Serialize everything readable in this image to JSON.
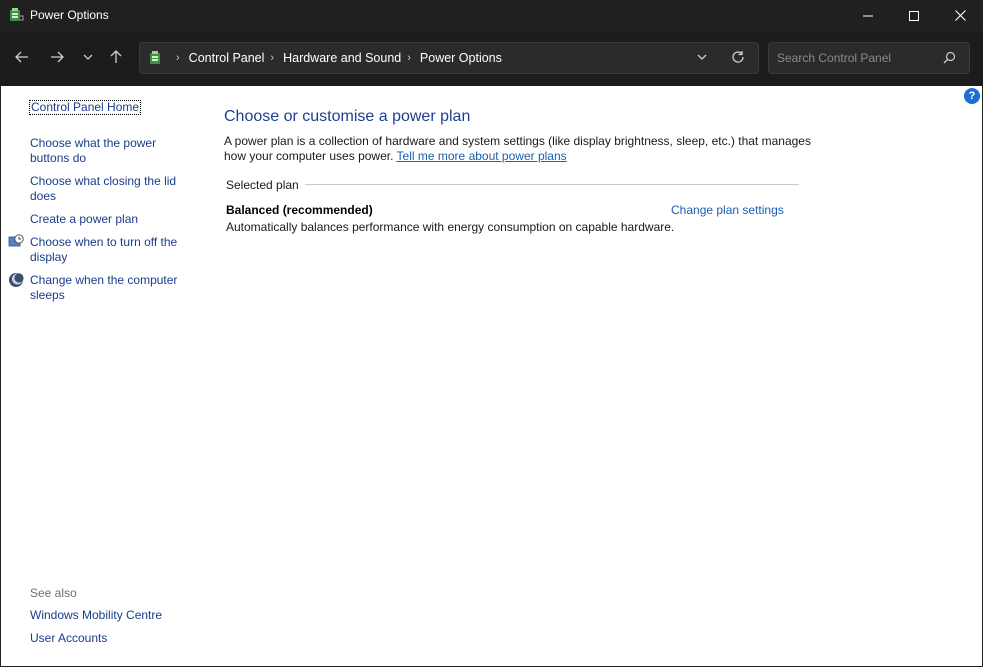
{
  "window": {
    "title": "Power Options",
    "minimize_glyph": "—",
    "maximize_glyph": "☐",
    "close_glyph": "✕"
  },
  "nav": {
    "back_icon": "arrow-left-icon",
    "forward_icon": "arrow-right-icon",
    "recent_icon": "chevron-down-icon",
    "up_icon": "arrow-up-icon"
  },
  "address": {
    "crumbs": [
      "Control Panel",
      "Hardware and Sound",
      "Power Options"
    ],
    "separator": "›"
  },
  "search": {
    "placeholder": "Search Control Panel"
  },
  "sidebar": {
    "home": "Control Panel Home",
    "links": [
      "Choose what the power buttons do",
      "Choose what closing the lid does",
      "Create a power plan",
      "Choose when to turn off the display",
      "Change when the computer sleeps"
    ],
    "see_also_label": "See also",
    "see_also_links": [
      "Windows Mobility Centre",
      "User Accounts"
    ]
  },
  "main": {
    "heading": "Choose or customise a power plan",
    "description": "A power plan is a collection of hardware and system settings (like display brightness, sleep, etc.) that manages how your computer uses power.",
    "learn_more_link": "Tell me more about power plans",
    "section_label": "Selected plan",
    "plan_name": "Balanced (recommended)",
    "plan_description": "Automatically balances performance with energy consumption on capable hardware.",
    "change_plan_link": "Change plan settings",
    "help_glyph": "?"
  },
  "colors": {
    "titlebar_bg": "#202020",
    "content_bg": "#ffffff",
    "link": "#1a5fb4",
    "heading": "#1e3f8f"
  }
}
